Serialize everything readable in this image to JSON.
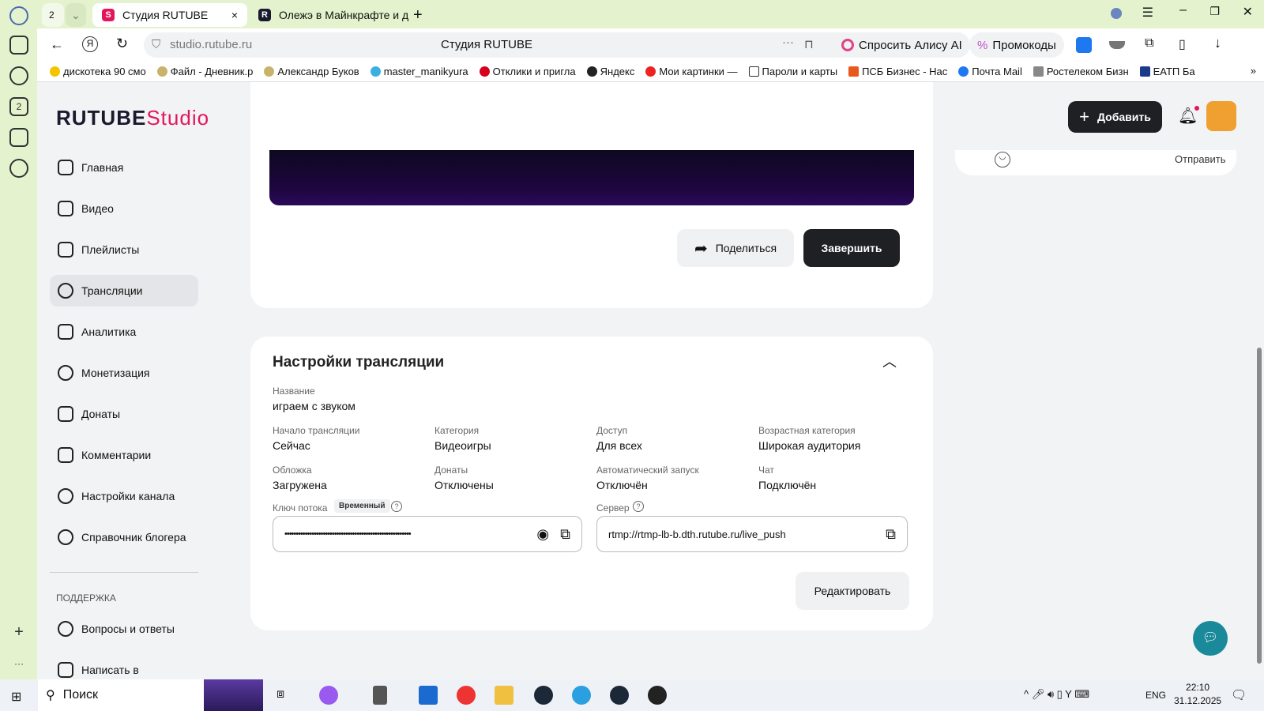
{
  "browser": {
    "tab_count": "2",
    "tabs": [
      {
        "title": "Студия RUTUBE",
        "active": true
      },
      {
        "title": "Олежэ в Майнкрафте и д"
      }
    ],
    "address": "studio.rutube.ru",
    "page_title": "Студия RUTUBE",
    "alice": "Спросить Алису AI",
    "promo": "Промокоды",
    "bookmarks": [
      "дискотека 90 смо",
      "Файл - Дневник.р",
      "Александр Буков",
      "master_manikyura",
      "Отклики и пригла",
      "Яндекс",
      "Мои картинки —",
      "Пароли и карты",
      "ПСБ Бизнес - Нас",
      "Почта Mail",
      "Ростелеком Бизн",
      "ЕАТП Ба"
    ]
  },
  "header": {
    "logo_main": "RUTUBE",
    "logo_sub": "Studio",
    "add_label": "Добавить"
  },
  "sidebar": {
    "items": [
      "Главная",
      "Видео",
      "Плейлисты",
      "Трансляции",
      "Аналитика",
      "Монетизация",
      "Донаты",
      "Комментарии",
      "Настройки канала",
      "Справочник блогера"
    ],
    "active": 3,
    "support_title": "ПОДДЕРЖКА",
    "support_items": [
      "Вопросы и ответы",
      "Написать в"
    ]
  },
  "chat": {
    "send": "Отправить"
  },
  "stream": {
    "share": "Поделиться",
    "finish": "Завершить"
  },
  "settings": {
    "title": "Настройки трансляции",
    "name_label": "Название",
    "name_value": "играем с звуком",
    "fields": [
      {
        "label": "Начало трансляции",
        "value": "Сейчас"
      },
      {
        "label": "Категория",
        "value": "Видеоигры"
      },
      {
        "label": "Доступ",
        "value": "Для всех"
      },
      {
        "label": "Возрастная категория",
        "value": "Широкая аудитория"
      },
      {
        "label": "Обложка",
        "value": "Загружена"
      },
      {
        "label": "Донаты",
        "value": "Отключены"
      },
      {
        "label": "Автоматический запуск",
        "value": "Отключён"
      },
      {
        "label": "Чат",
        "value": "Подключён"
      }
    ],
    "key_label": "Ключ потока",
    "key_badge": "Временный",
    "key_value": "••••••••••••••••••••••••••••••••••••••••••••••••••••••••",
    "server_label": "Сервер",
    "server_value": "rtmp://rtmp-lb-b.dth.rutube.ru/live_push",
    "edit": "Редактировать"
  },
  "taskbar": {
    "search": "Поиск",
    "lang": "ENG",
    "time": "22:10",
    "date": "31.12.2025"
  }
}
